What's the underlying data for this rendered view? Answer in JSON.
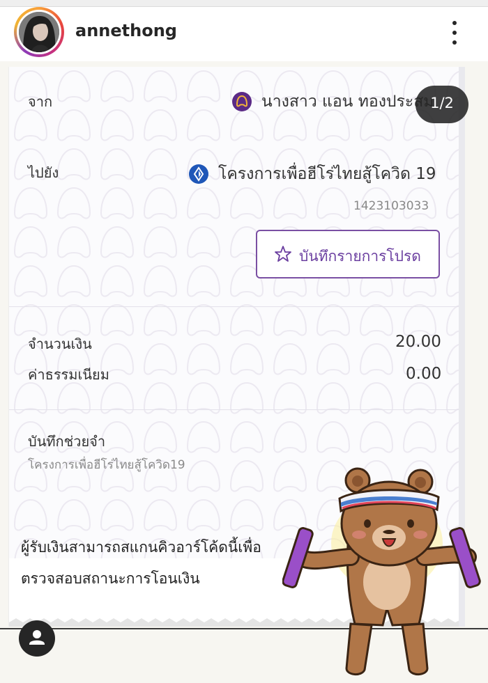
{
  "post": {
    "username": "annethong",
    "counter": "1/2",
    "icons": [
      "more-options-icon",
      "profile-icon",
      "star-icon",
      "bank-logo-icon"
    ]
  },
  "slip": {
    "from_label": "จาก",
    "from_name": "นางสาว แอน ทองประสม",
    "to_label": "ไปยัง",
    "to_name": "โครงการเพื่อฮีโร่ไทยสู้โควิด 19",
    "account_number": "1423103033",
    "favorite_button": "บันทึกรายการโปรด",
    "amount_label": "จำนวนเงิน",
    "amount_value": "20.00",
    "fee_label": "ค่าธรรมเนียม",
    "fee_value": "0.00",
    "memo_label": "บันทึกช่วยจำ",
    "memo_text": "โครงการเพื่อฮีโร่ไทยสู้โควิด19",
    "qr_note_line1": "ผู้รับเงินสามารถสแกนคิวอาร์โค้ดนี้เพื่อ",
    "qr_note_line2": "ตรวจสอบสถานะการโอนเงิน"
  },
  "colors": {
    "purple_accent": "#6b3fa0",
    "scb_purple": "#5b2a86",
    "krungsri_blue": "#1f57b8",
    "pattern": "#ece9f1"
  }
}
